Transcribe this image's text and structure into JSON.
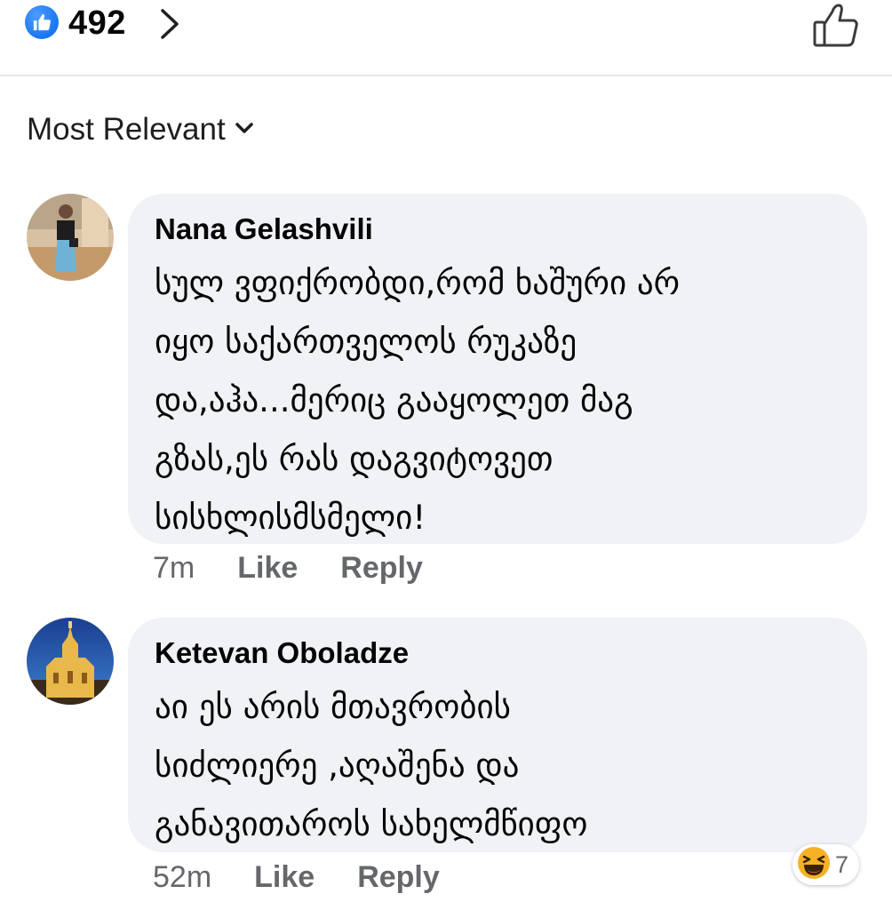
{
  "header": {
    "reaction_count": "492",
    "like_badge_icon": "thumbs-up-icon",
    "open_reactions_icon": "chevron-right-icon",
    "like_post_icon": "thumbs-up-outline-icon"
  },
  "sort": {
    "label": "Most Relevant",
    "icon": "chevron-down-icon"
  },
  "comments": [
    {
      "author": "Nana Gelashvili",
      "text": "სულ ვფიქრობდი,რომ ხაშური არ\nიყო  საქართველოს რუკაზე\nდა,აჰა...მერიც გააყოლეთ მაგ\nგზას,ეს რას დაგვიტოვეთ\nსისხლისმსმელი!",
      "time": "7m",
      "like_label": "Like",
      "reply_label": "Reply"
    },
    {
      "author": "Ketevan Oboladze",
      "text": "აი ეს არის მთავრობის\nსიძლიერე ,აღაშენა და\nგანავითაროს სახელმწიფო",
      "time": "52m",
      "like_label": "Like",
      "reply_label": "Reply",
      "reaction": {
        "icon": "haha-emoji-icon",
        "count": "7"
      }
    }
  ],
  "colors": {
    "accent": "#1877f2",
    "bubble": "#f0f2f5",
    "secondary_text": "#65676b",
    "divider": "#e4e6eb"
  }
}
